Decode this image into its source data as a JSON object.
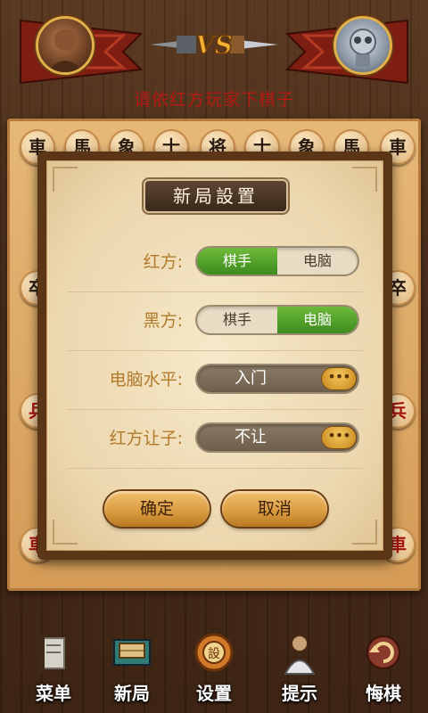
{
  "header": {
    "turn_text": "请依红方玩家下棋子",
    "vs_label": "VS"
  },
  "board": {
    "top_row": [
      "車",
      "馬",
      "象",
      "士",
      "将",
      "士",
      "象",
      "馬",
      "車"
    ],
    "left_col": [
      "卒",
      "兵",
      "車"
    ],
    "right_col": [
      "卒",
      "兵",
      "車"
    ]
  },
  "dialog": {
    "title": "新局設置",
    "rows": [
      {
        "label": "红方:",
        "options": [
          "棋手",
          "电脑"
        ],
        "selected": 0
      },
      {
        "label": "黑方:",
        "options": [
          "棋手",
          "电脑"
        ],
        "selected": 1
      },
      {
        "label": "电脑水平:",
        "value": "入门",
        "more": "•••"
      },
      {
        "label": "红方让子:",
        "value": "不让",
        "more": "•••"
      }
    ],
    "confirm_label": "确定",
    "cancel_label": "取消"
  },
  "menu": {
    "items": [
      {
        "label": "菜单",
        "icon": "scroll-icon"
      },
      {
        "label": "新局",
        "icon": "new-board-icon"
      },
      {
        "label": "设置",
        "icon": "settings-seal-icon"
      },
      {
        "label": "提示",
        "icon": "hint-sage-icon"
      },
      {
        "label": "悔棋",
        "icon": "undo-icon"
      }
    ]
  },
  "colors": {
    "accent_green": "#4a9a24",
    "red_text": "#b41a12",
    "label_gold": "#b07a2a"
  }
}
